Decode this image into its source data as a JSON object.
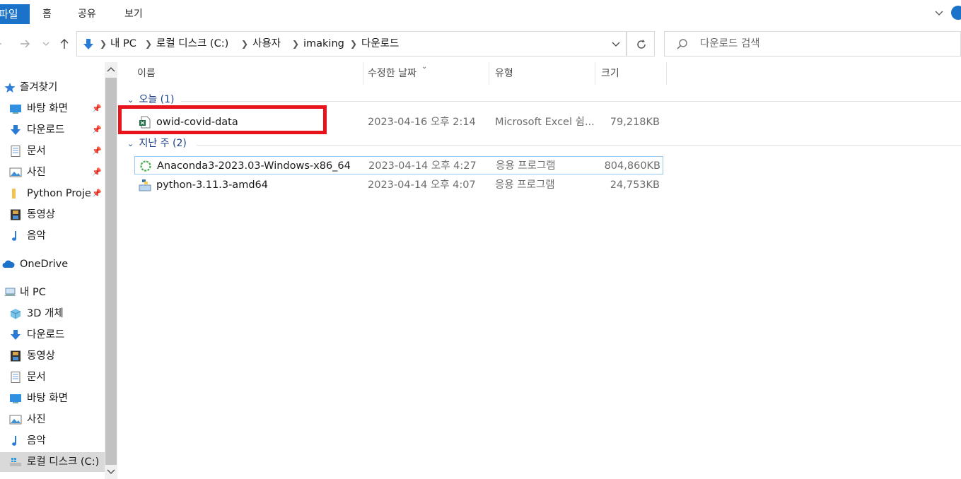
{
  "ribbon": {
    "file_tab": "파일",
    "tabs": [
      "홈",
      "공유",
      "보기"
    ]
  },
  "address": {
    "crumbs": [
      "내 PC",
      "로컬 디스크 (C:)",
      "사용자",
      "imaking",
      "다운로드"
    ]
  },
  "search": {
    "placeholder": "다운로드 검색"
  },
  "sidebar": {
    "items": [
      {
        "label": "즐겨찾기",
        "icon": "star-icon"
      },
      {
        "label": "바탕 화면",
        "icon": "desktop-icon",
        "pinned": true
      },
      {
        "label": "다운로드",
        "icon": "download-arrow-icon",
        "pinned": true
      },
      {
        "label": "문서",
        "icon": "document-icon",
        "pinned": true
      },
      {
        "label": "사진",
        "icon": "picture-icon",
        "pinned": true
      },
      {
        "label": "Python Proje",
        "icon": "folder-icon",
        "pinned": true
      },
      {
        "label": "동영상",
        "icon": "film-icon"
      },
      {
        "label": "음악",
        "icon": "music-note-icon"
      },
      {
        "label": "OneDrive",
        "icon": "cloud-icon"
      },
      {
        "label": "내 PC",
        "icon": "computer-icon"
      },
      {
        "label": "3D 개체",
        "icon": "cube-icon"
      },
      {
        "label": "다운로드",
        "icon": "download-arrow-icon"
      },
      {
        "label": "동영상",
        "icon": "film-icon"
      },
      {
        "label": "문서",
        "icon": "document-icon"
      },
      {
        "label": "바탕 화면",
        "icon": "desktop-icon"
      },
      {
        "label": "사진",
        "icon": "picture-icon"
      },
      {
        "label": "음악",
        "icon": "music-note-icon"
      },
      {
        "label": "로컬 디스크 (C:)",
        "icon": "drive-icon",
        "selected": true
      }
    ]
  },
  "columns": {
    "name": "이름",
    "modified": "수정한 날짜",
    "type": "유형",
    "size": "크기"
  },
  "groups": [
    {
      "label": "오늘 (1)",
      "files": [
        {
          "name": "owid-covid-data",
          "modified": "2023-04-16 오후 2:14",
          "type": "Microsoft Excel 쉼...",
          "size": "79,218KB",
          "icon": "excel-csv-icon"
        }
      ]
    },
    {
      "label": "지난 주 (2)",
      "files": [
        {
          "name": "Anaconda3-2023.03-Windows-x86_64",
          "modified": "2023-04-14 오후 4:27",
          "type": "응용 프로그램",
          "size": "804,860KB",
          "icon": "anaconda-icon"
        },
        {
          "name": "python-3.11.3-amd64",
          "modified": "2023-04-14 오후 4:07",
          "type": "응용 프로그램",
          "size": "24,753KB",
          "icon": "python-installer-icon"
        }
      ]
    }
  ],
  "colors": {
    "file_tab_bg": "#1a73c8",
    "selection_bg": "#d9d9d9",
    "group_text": "#1e3f86",
    "highlight_box": "#e8141c",
    "hover_border": "#99c9ef"
  }
}
